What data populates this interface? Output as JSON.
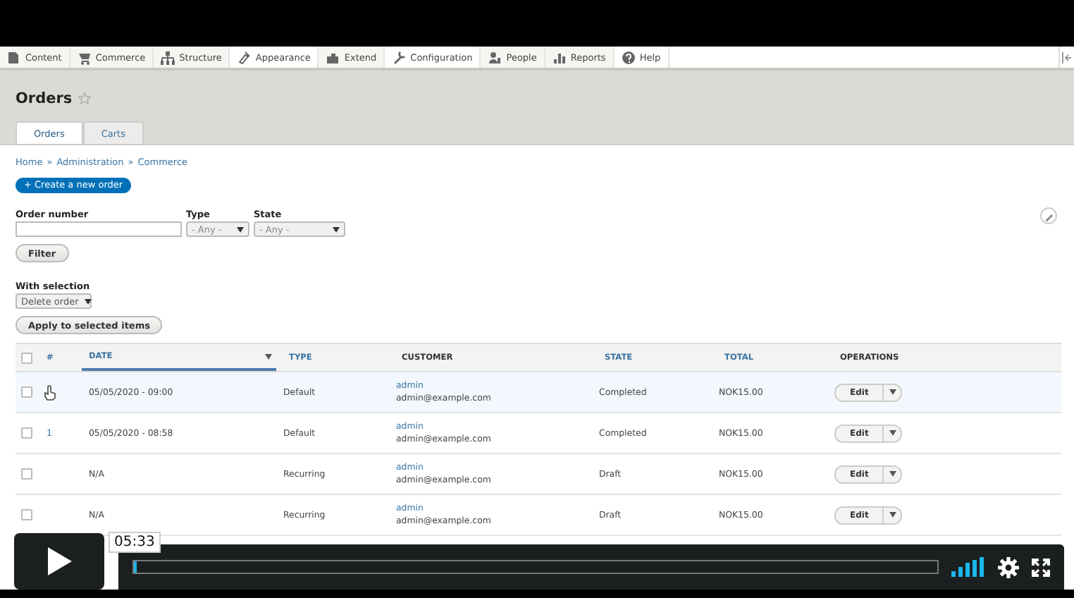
{
  "toolbar": {
    "items": [
      {
        "label": "Content"
      },
      {
        "label": "Commerce"
      },
      {
        "label": "Structure"
      },
      {
        "label": "Appearance"
      },
      {
        "label": "Extend"
      },
      {
        "label": "Configuration"
      },
      {
        "label": "People"
      },
      {
        "label": "Reports"
      },
      {
        "label": "Help"
      }
    ]
  },
  "page": {
    "title": "Orders",
    "favorite": false
  },
  "tabs": [
    {
      "label": "Orders",
      "selected": true
    },
    {
      "label": "Carts",
      "selected": false
    }
  ],
  "breadcrumb": [
    "Home",
    "Administration",
    "Commerce"
  ],
  "breadcrumb_separator": "»",
  "create_button": "+ Create a new order",
  "filters": [
    {
      "kind": "text",
      "label": "Order number"
    },
    {
      "kind": "select",
      "label": "Type",
      "value": "- Any -"
    },
    {
      "kind": "select",
      "label": "State",
      "value": "- Any -"
    }
  ],
  "filter_button": "Filter",
  "bulk": {
    "label": "With selection",
    "value": "Delete order",
    "button": "Apply to selected items"
  },
  "table": {
    "select_all_checked": false,
    "columns": [
      {
        "label": "#",
        "sortable": true,
        "sorted": false
      },
      {
        "label": "DATE",
        "sortable": true,
        "sorted": true
      },
      {
        "label": "TYPE",
        "sortable": true,
        "sorted": false
      },
      {
        "label": "CUSTOMER",
        "sortable": false
      },
      {
        "label": "STATE",
        "sortable": true,
        "sorted": false
      },
      {
        "label": "TOTAL",
        "sortable": true,
        "sorted": false
      },
      {
        "label": "OPERATIONS",
        "sortable": false
      }
    ],
    "rows": [
      {
        "checked": false,
        "highlighted": true,
        "number": "",
        "date": "05/05/2020 - 09:00",
        "type": "Default",
        "customer_name": "admin",
        "customer_email": "admin@example.com",
        "state": "Completed",
        "total": "NOK15.00",
        "operation": "Edit"
      },
      {
        "checked": false,
        "highlighted": false,
        "number": "1",
        "date": "05/05/2020 - 08:58",
        "type": "Default",
        "customer_name": "admin",
        "customer_email": "admin@example.com",
        "state": "Completed",
        "total": "NOK15.00",
        "operation": "Edit"
      },
      {
        "checked": false,
        "highlighted": false,
        "number": "",
        "date": "N/A",
        "type": "Recurring",
        "customer_name": "admin",
        "customer_email": "admin@example.com",
        "state": "Draft",
        "total": "NOK15.00",
        "operation": "Edit"
      },
      {
        "checked": false,
        "highlighted": false,
        "number": "",
        "date": "N/A",
        "type": "Recurring",
        "customer_name": "admin",
        "customer_email": "admin@example.com",
        "state": "Draft",
        "total": "NOK15.00",
        "operation": "Edit"
      }
    ]
  },
  "player": {
    "timestamp": "05:33",
    "progress": {
      "level": 0
    }
  }
}
